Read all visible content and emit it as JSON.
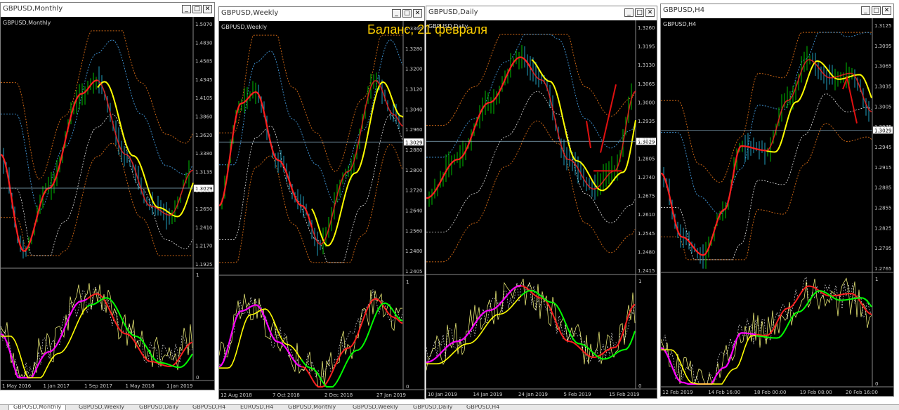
{
  "banner": "Баланс, 21 февраля",
  "tabs": [
    {
      "label": "GBPUSD,Monthly",
      "active": true
    },
    {
      "label": "GBPUSD,Weekly"
    },
    {
      "label": "GBPUSD,Daily"
    },
    {
      "label": "GBPUSD,H4"
    },
    {
      "label": "EURUSD,H4"
    },
    {
      "label": "GBPUSD,Monthly"
    },
    {
      "label": "GBPUSD,Weekly"
    },
    {
      "label": "GBPUSD,Daily"
    },
    {
      "label": "GBPUSD,H4"
    }
  ],
  "colors": {
    "bars_up": "#00c000",
    "bars_down": "#1fa0c0",
    "fast_ma": "#ff2020",
    "slow_ma": "#ffff00",
    "osc_a": "#ff00ff",
    "osc_b": "#00ff00",
    "band": "#c86414",
    "env": "#3c8cc8",
    "price_line": "#8cb4c8",
    "arrow": "#e01010"
  },
  "windows": [
    {
      "title": "GBPUSD,Monthly",
      "chart_label": "GBPUSD,Monthly",
      "price_ticks": [
        "1.5070",
        "1.4830",
        "1.4585",
        "1.4345",
        "1.4105",
        "1.3860",
        "1.3620",
        "1.3380",
        "1.3135",
        "1.2895",
        "1.2650",
        "1.2410",
        "1.2170",
        "1.1925"
      ],
      "current_price": "1.3029",
      "osc_ticks": [
        "1",
        "0"
      ],
      "date_ticks": [
        "1 May 2016",
        "1 Jan 2017",
        "1 Sep 2017",
        "1 May 2018",
        "1 Jan 2019"
      ]
    },
    {
      "title": "GBPUSD,Weekly",
      "chart_label": "GBPUSD,Weekly",
      "price_ticks": [
        "1.3360",
        "1.3280",
        "1.3200",
        "1.3120",
        "1.3040",
        "1.2960",
        "1.2880",
        "1.2800",
        "1.2720",
        "1.2640",
        "1.2560",
        "1.2480",
        "1.2405"
      ],
      "current_price": "1.3029",
      "osc_ticks": [
        "1",
        "0"
      ],
      "date_ticks": [
        "12 Aug 2018",
        "7 Oct 2018",
        "2 Dec 2018",
        "27 Jan 2019"
      ]
    },
    {
      "title": "GBPUSD,Daily",
      "chart_label": "GBPUSD,Daily",
      "price_ticks": [
        "1.3260",
        "1.3195",
        "1.3130",
        "1.3065",
        "1.3000",
        "1.2935",
        "1.2870",
        "1.2805",
        "1.2740",
        "1.2675",
        "1.2610",
        "1.2545",
        "1.2480",
        "1.2415"
      ],
      "current_price": "1.3029",
      "osc_ticks": [
        "1",
        "0"
      ],
      "date_ticks": [
        "10 Jan 2019",
        "14 Jan 2019",
        "24 Jan 2019",
        "5 Feb 2019",
        "15 Feb 2019"
      ]
    },
    {
      "title": "GBPUSD,H4",
      "chart_label": "GBPUSD,H4",
      "price_ticks": [
        "1.3125",
        "1.3095",
        "1.3065",
        "1.3035",
        "1.3005",
        "1.2975",
        "1.2945",
        "1.2915",
        "1.2885",
        "1.2855",
        "1.2825",
        "1.2795",
        "1.2765"
      ],
      "current_price": "1.3029",
      "osc_ticks": [
        "1",
        "0"
      ],
      "date_ticks": [
        "12 Feb 2019",
        "14 Feb 16:00",
        "18 Feb 00:00",
        "19 Feb 08:00",
        "20 Feb 16:00"
      ]
    }
  ]
}
